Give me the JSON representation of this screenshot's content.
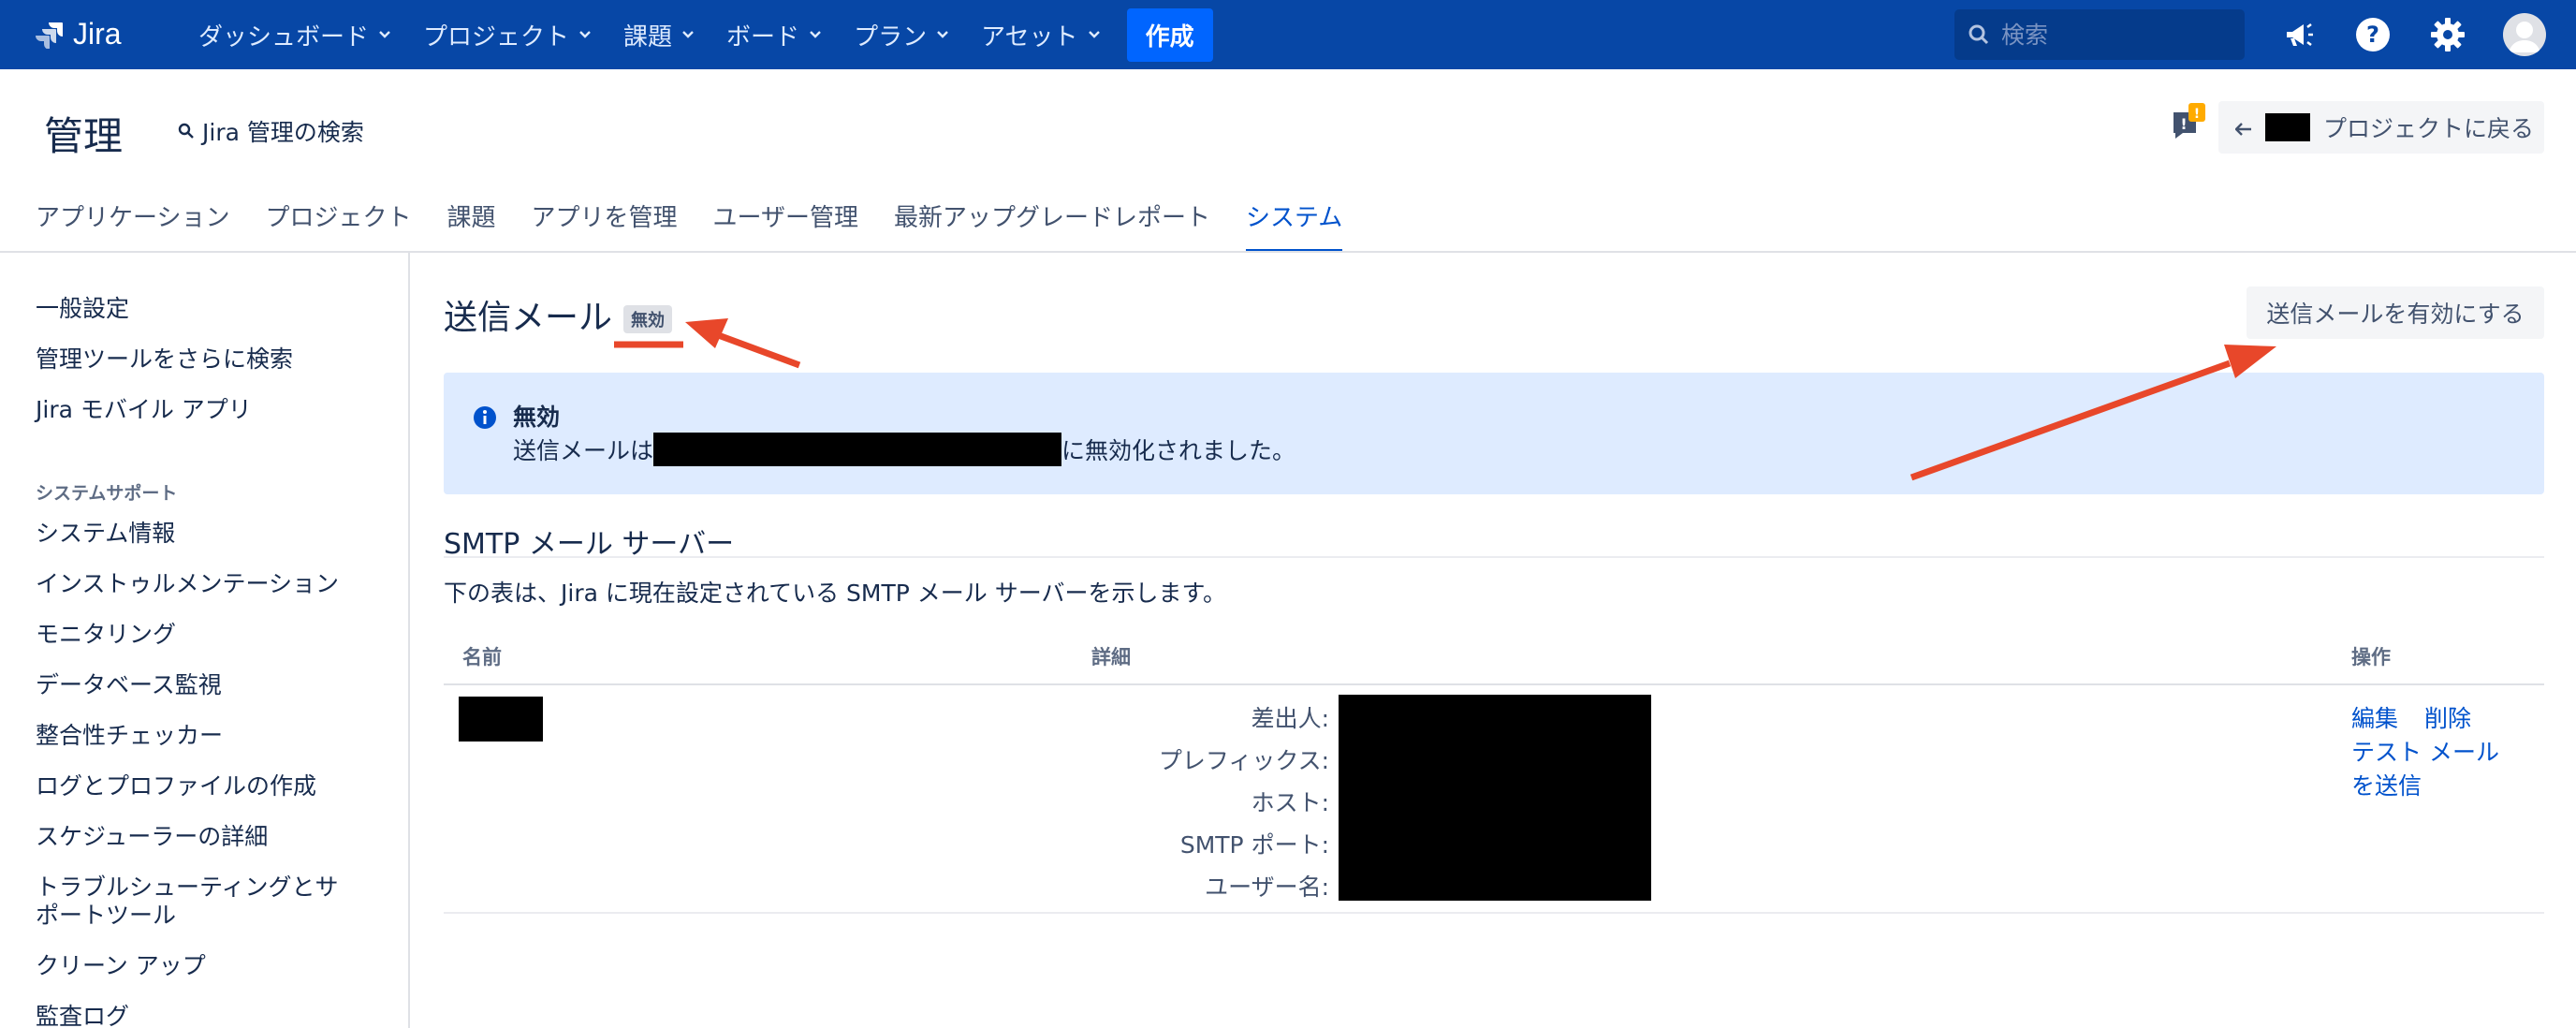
{
  "topbar": {
    "logo_text": "Jira",
    "nav": [
      {
        "label": "ダッシュボード"
      },
      {
        "label": "プロジェクト"
      },
      {
        "label": "課題"
      },
      {
        "label": "ボード"
      },
      {
        "label": "プラン"
      },
      {
        "label": "アセット"
      }
    ],
    "create_label": "作成",
    "search_placeholder": "検索",
    "icons": [
      "megaphone-icon",
      "help-icon",
      "settings-gear-icon",
      "user-avatar"
    ]
  },
  "header": {
    "title": "管理",
    "admin_search": "Jira 管理の検索",
    "feedback_badge": "!",
    "back_label": "プロジェクトに戻る"
  },
  "admin_tabs": [
    {
      "label": "アプリケーション",
      "active": false
    },
    {
      "label": "プロジェクト",
      "active": false
    },
    {
      "label": "課題",
      "active": false
    },
    {
      "label": "アプリを管理",
      "active": false
    },
    {
      "label": "ユーザー管理",
      "active": false
    },
    {
      "label": "最新アップグレードレポート",
      "active": false
    },
    {
      "label": "システム",
      "active": true
    }
  ],
  "sidebar": {
    "items_top": [
      "一般設定",
      "管理ツールをさらに検索",
      "Jira モバイル アプリ"
    ],
    "section_heading": "システムサポート",
    "items": [
      "システム情報",
      "インストゥルメンテーション",
      "モニタリング",
      "データベース監視",
      "整合性チェッカー",
      "ログとプロファイルの作成",
      "スケジューラーの詳細",
      "トラブルシューティングとサ",
      "ポートツール",
      "クリーン アップ",
      "監査ログ"
    ]
  },
  "main": {
    "title": "送信メール",
    "status_lozenge": "無効",
    "enable_button": "送信メールを有効にする",
    "info": {
      "title": "無効",
      "body_prefix": "送信メールは",
      "body_suffix": "に無効化されました。"
    },
    "smtp": {
      "section_title": "SMTP メール サーバー",
      "description": "下の表は、Jira に現在設定されている SMTP メール サーバーを示します。",
      "columns": [
        "名前",
        "詳細",
        "操作"
      ],
      "detail_labels": [
        "差出人:",
        "プレフィックス:",
        "ホスト:",
        "SMTP ポート:",
        "ユーザー名:"
      ],
      "operations": {
        "edit": "編集",
        "delete": "削除",
        "test_line1": "テスト メール",
        "test_line2": "を送信"
      }
    }
  },
  "colors": {
    "topbar": "#0747a6",
    "link": "#0052cc",
    "info_bg": "#deebff",
    "annotation": "#e8472a"
  }
}
